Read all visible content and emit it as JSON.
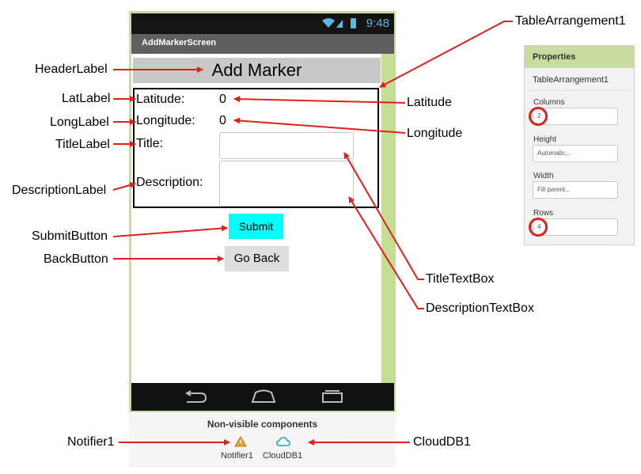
{
  "phone": {
    "status_time": "9:48",
    "screen_title": "AddMarkerScreen",
    "header": "Add Marker",
    "latitude_label": "Latitude:",
    "latitude_value": "0",
    "longitude_label": "Longitude:",
    "longitude_value": "0",
    "title_label": "Title:",
    "description_label": "Description:",
    "submit_label": "Submit",
    "back_label": "Go Back"
  },
  "non_visible": {
    "title": "Non-visible components",
    "items": [
      {
        "label": "Notifier1",
        "icon": "notifier-icon"
      },
      {
        "label": "CloudDB1",
        "icon": "cloud-icon"
      }
    ]
  },
  "properties": {
    "header": "Properties",
    "component": "TableArrangement1",
    "columns_label": "Columns",
    "columns_value": "2",
    "height_label": "Height",
    "height_value": "Automatic...",
    "width_label": "Width",
    "width_value": "Fill parent...",
    "rows_label": "Rows",
    "rows_value": "4"
  },
  "annotations": {
    "header_label": "HeaderLabel",
    "lat_label": "LatLabel",
    "long_label": "LongLabel",
    "title_label": "TitleLabel",
    "description_label": "DescriptionLabel",
    "submit_button": "SubmitButton",
    "back_button": "BackButton",
    "notifier": "Notifier1",
    "table_arrangement": "TableArrangement1",
    "latitude": "Latitude",
    "longitude": "Longitude",
    "title_textbox": "TitleTextBox",
    "description_textbox": "DescriptionTextBox",
    "clouddb": "CloudDB1"
  },
  "colors": {
    "accent_green": "#c5dd95",
    "arrow_red": "#e0201c",
    "submit_cyan": "#00ffff",
    "status_blue": "#58b8e6"
  }
}
